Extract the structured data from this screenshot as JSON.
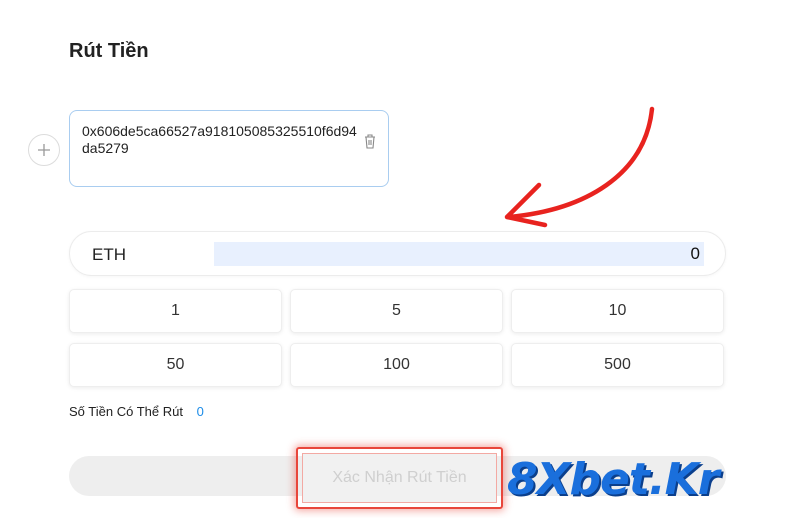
{
  "page": {
    "title": "Rút Tiền"
  },
  "wallet": {
    "address": "0x606de5ca66527a918105085325510f6d94da5279"
  },
  "amount": {
    "currency": "ETH",
    "value": "0"
  },
  "presets": [
    "1",
    "5",
    "10",
    "50",
    "100",
    "500"
  ],
  "available": {
    "label": "Số Tiền Có Thể Rút",
    "value": "0"
  },
  "confirm": {
    "label": "Xác Nhận Rút Tiền"
  },
  "logo": {
    "text_main": "8Xbet",
    "text_dot": ".",
    "text_tld": "Kr"
  },
  "colors": {
    "accent_blue": "#1c8ce8",
    "highlight_red": "#e8463b",
    "input_fill": "#e8f0fe"
  }
}
